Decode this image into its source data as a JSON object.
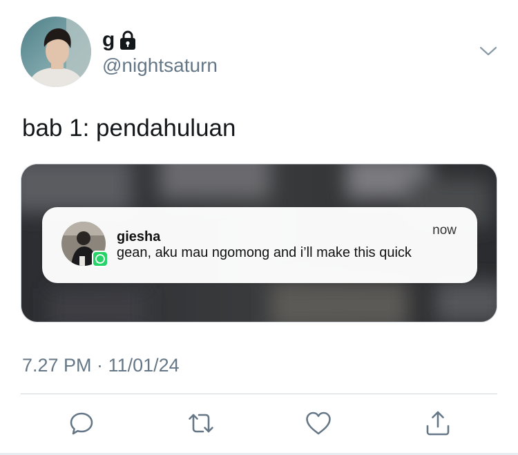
{
  "tweet": {
    "display_name": "g",
    "handle": "@nightsaturn",
    "text": "bab 1: pendahuluan",
    "timestamp": "7.27 PM · 11/01/24",
    "icons": {
      "lock": "lock-icon",
      "more": "chevron-down-icon"
    }
  },
  "notification": {
    "sender": "giesha",
    "message": "gean, aku mau ngomong and i’ll make this quick",
    "time": "now",
    "app_badge": "whatsapp-icon"
  },
  "actions": [
    {
      "name": "reply",
      "icon": "reply-icon"
    },
    {
      "name": "retweet",
      "icon": "retweet-icon"
    },
    {
      "name": "like",
      "icon": "heart-icon"
    },
    {
      "name": "share",
      "icon": "share-icon"
    }
  ],
  "colors": {
    "text": "#14171a",
    "secondary": "#657786",
    "whatsapp": "#25d366"
  }
}
